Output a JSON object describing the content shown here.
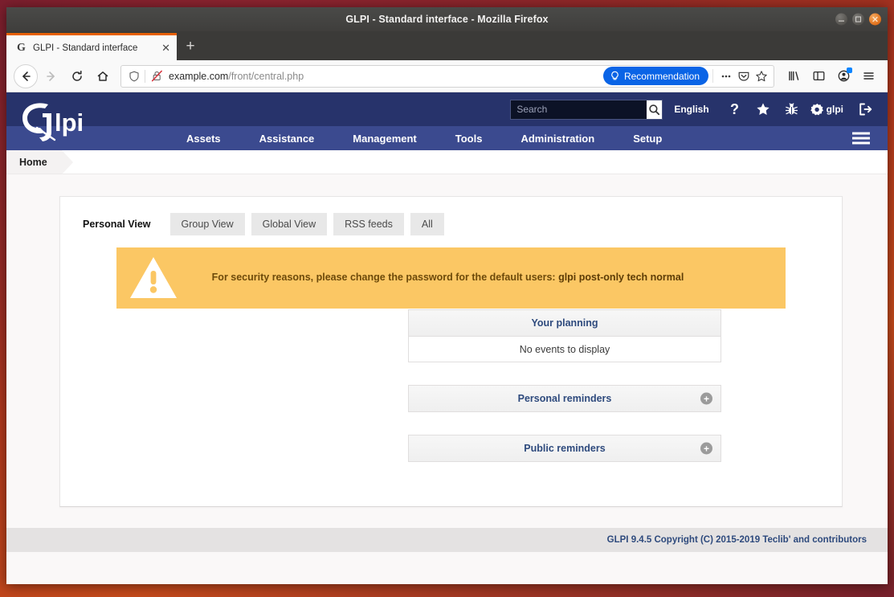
{
  "window": {
    "title": "GLPI - Standard interface - Mozilla Firefox",
    "minimize_label": "—",
    "maximize_label": "▢",
    "close_label": "✕"
  },
  "browser": {
    "tab": {
      "favicon": "glpi-favicon",
      "title": "GLPI - Standard interface",
      "close_label": "✕"
    },
    "new_tab_label": "+",
    "nav": {
      "back": "back-arrow-icon",
      "forward": "forward-arrow-icon",
      "reload": "reload-icon",
      "home": "home-icon"
    },
    "url": {
      "host": "example.com",
      "path": "/front/central.php",
      "shield_icon": "tracking-protection-shield-icon",
      "lock_icon": "insecure-connection-icon",
      "recommendation_label": "Recommendation",
      "recommendation_icon": "lightbulb-icon",
      "more_icon": "page-actions-ellipsis-icon",
      "pocket_icon": "pocket-icon",
      "bookmark_icon": "bookmark-star-icon",
      "accent": "#0a64e6"
    },
    "toolbar_right": {
      "library_icon": "library-icon",
      "sidebar_icon": "sidebar-icon",
      "account_icon": "firefox-account-icon",
      "menu_icon": "hamburger-menu-icon"
    }
  },
  "glpi": {
    "logo_text": "glpi",
    "search": {
      "placeholder": "Search",
      "value": "",
      "button_icon": "search-icon"
    },
    "language": "English",
    "header_icons": [
      {
        "name": "help-icon",
        "glyph": "?"
      },
      {
        "name": "favorites-star-icon",
        "glyph": "★"
      },
      {
        "name": "bug-debug-icon",
        "glyph": "🐞"
      },
      {
        "name": "preferences-gear-icon",
        "glyph": "✹"
      },
      {
        "name": "logout-icon",
        "glyph": "⇥"
      }
    ],
    "user": "glpi",
    "menu": [
      {
        "label": "Assets"
      },
      {
        "label": "Assistance"
      },
      {
        "label": "Management"
      },
      {
        "label": "Tools"
      },
      {
        "label": "Administration"
      },
      {
        "label": "Setup"
      }
    ],
    "menu_toggle_icon": "hamburger-menu-icon",
    "breadcrumb": "Home",
    "tabs": [
      {
        "label": "Personal View",
        "active": true
      },
      {
        "label": "Group View",
        "active": false
      },
      {
        "label": "Global View",
        "active": false
      },
      {
        "label": "RSS feeds",
        "active": false
      },
      {
        "label": "All",
        "active": false
      }
    ],
    "alert": {
      "icon": "warning-triangle-icon",
      "message": "For security reasons, please change the password for the default users:",
      "users": "glpi post-only tech normal",
      "background": "#fbc764"
    },
    "widgets": [
      {
        "title": "Your planning",
        "body": "No events to display",
        "has_body": true,
        "has_plus": false,
        "plus_label": ""
      },
      {
        "title": "Personal reminders",
        "body": "",
        "has_body": false,
        "has_plus": true,
        "plus_label": "+"
      },
      {
        "title": "Public reminders",
        "body": "",
        "has_body": false,
        "has_plus": true,
        "plus_label": "+"
      }
    ],
    "footer": "GLPI 9.4.5 Copyright (C) 2015-2019 Teclib' and contributors",
    "colors": {
      "topbar": "#27336b",
      "menubar": "#3b4a8f",
      "link": "#2e4a7d"
    }
  }
}
